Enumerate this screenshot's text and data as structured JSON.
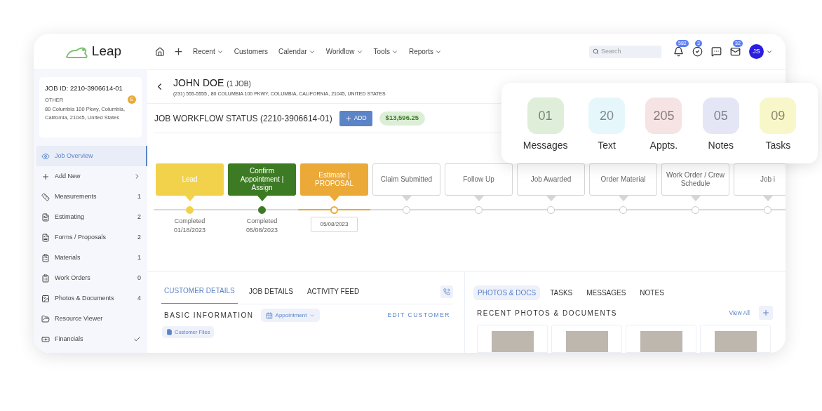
{
  "brand": {
    "name": "Leap"
  },
  "nav": [
    {
      "label": "Recent",
      "dropdown": true
    },
    {
      "label": "Customers",
      "dropdown": false
    },
    {
      "label": "Calendar",
      "dropdown": true
    },
    {
      "label": "Workflow",
      "dropdown": true
    },
    {
      "label": "Tools",
      "dropdown": true
    },
    {
      "label": "Reports",
      "dropdown": true
    }
  ],
  "search": {
    "placeholder": "Search"
  },
  "header_icons": [
    {
      "kind": "bell",
      "badge": "582"
    },
    {
      "kind": "check",
      "badge": "3"
    },
    {
      "kind": "chat"
    },
    {
      "kind": "mail",
      "badge": "32"
    }
  ],
  "user": {
    "initials": "JS"
  },
  "job_card": {
    "job_id": "JOB ID: 2210-3906614-01",
    "type": "OTHER",
    "badge": "E",
    "address": "80 Columbia 100 Pkwy, Columbia, California, 21045, United States"
  },
  "sidebar": {
    "items": [
      {
        "label": "Job Overview",
        "kind": "plain",
        "selected": true
      },
      {
        "label": "Add New",
        "kind": "submenu",
        "selected": false
      },
      {
        "label": "Measurements",
        "kind": "count",
        "count": "1",
        "selected": false
      },
      {
        "label": "Estimating",
        "kind": "count",
        "count": "2",
        "selected": false
      },
      {
        "label": "Forms / Proposals",
        "kind": "count",
        "count": "2",
        "selected": false
      },
      {
        "label": "Materials",
        "kind": "count",
        "count": "1",
        "selected": false
      },
      {
        "label": "Work Orders",
        "kind": "count",
        "count": "0",
        "selected": false
      },
      {
        "label": "Photos & Documents",
        "kind": "count",
        "count": "4",
        "selected": false
      },
      {
        "label": "Resource Viewer",
        "kind": "plain",
        "selected": false
      },
      {
        "label": "Financials",
        "kind": "check",
        "selected": false
      }
    ]
  },
  "customer": {
    "name": "JOHN DOE",
    "jobs": "(1 JOB)",
    "details": "(231) 555-5555 , 80 COLUMBIA 100 PKWY, COLUMBIA, CALIFORNIA, 21045, UNITED STATES"
  },
  "workflow": {
    "title": "JOB WORKFLOW STATUS (2210-3906614-01)",
    "add_button": "ADD",
    "amount": "$13,596.25"
  },
  "stages": [
    {
      "label": "Lead",
      "completed": true,
      "selected": false,
      "color": "#f2d24a",
      "caption": "Completed",
      "date": "01/18/2023"
    },
    {
      "label": "Confirm Appointment | Assign",
      "completed": true,
      "selected": false,
      "color": "#3d7a24",
      "caption": "Completed",
      "date": "05/08/2023"
    },
    {
      "label": "Estimate | PROPOSAL",
      "completed": false,
      "selected": true,
      "color": "#eba937",
      "date": "05/08/2023"
    },
    {
      "label": "Claim Submitted",
      "completed": false,
      "selected": false
    },
    {
      "label": "Follow Up",
      "completed": false,
      "selected": false
    },
    {
      "label": "Job Awarded",
      "completed": false,
      "selected": false
    },
    {
      "label": "Order Material",
      "completed": false,
      "selected": false
    },
    {
      "label": "Work Order / Crew Schedule",
      "completed": false,
      "selected": false
    },
    {
      "label": "Job i",
      "completed": false,
      "selected": false
    }
  ],
  "left_tabs": [
    {
      "label": "CUSTOMER DETAILS",
      "selected": true
    },
    {
      "label": "JOB DETAILS",
      "selected": false
    },
    {
      "label": "ACTIVITY FEED",
      "selected": false
    }
  ],
  "basic_info": {
    "title": "BASIC INFORMATION",
    "appointment": "Appointment",
    "edit": "EDIT CUSTOMER",
    "files": "Customer Files"
  },
  "right_tabs": [
    {
      "label": "PHOTOS & DOCS",
      "selected": true
    },
    {
      "label": "TASKS",
      "selected": false
    },
    {
      "label": "MESSAGES",
      "selected": false
    },
    {
      "label": "NOTES",
      "selected": false
    }
  ],
  "recent": {
    "title": "RECENT PHOTOS & DOCUMENTS",
    "view_all": "View All"
  },
  "summary": [
    {
      "count": "01",
      "label": "Messages",
      "color": "#dfeed9"
    },
    {
      "count": "20",
      "label": "Text",
      "color": "#e6f7fb"
    },
    {
      "count": "205",
      "label": "Appts.",
      "color": "#f6e3e3"
    },
    {
      "count": "05",
      "label": "Notes",
      "color": "#e4e6f6"
    },
    {
      "count": "09",
      "label": "Tasks",
      "color": "#f8f7c9"
    }
  ]
}
